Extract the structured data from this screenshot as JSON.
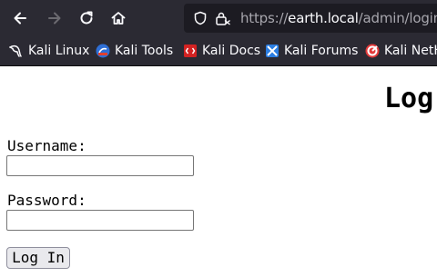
{
  "browser": {
    "url_scheme": "https://",
    "url_host": "earth.local",
    "url_path": "/admin/login",
    "nav": {
      "back_icon": "arrow-left-icon",
      "forward_icon": "arrow-right-icon",
      "reload_icon": "reload-icon",
      "home_icon": "home-icon"
    },
    "bookmarks": [
      {
        "label": "Kali Linux",
        "icon": "kali-dragon-icon"
      },
      {
        "label": "Kali Tools",
        "icon": "kali-tools-icon"
      },
      {
        "label": "Kali Docs",
        "icon": "kali-docs-icon"
      },
      {
        "label": "Kali Forums",
        "icon": "kali-forums-icon"
      },
      {
        "label": "Kali NetH",
        "icon": "kali-nethunter-icon"
      }
    ]
  },
  "page": {
    "title": "Log",
    "username_label": "Username:",
    "password_label": "Password:",
    "username_value": "",
    "password_value": "",
    "submit_label": "Log In"
  },
  "colors": {
    "toolbar_bg": "#2b2a33",
    "urlbar_bg": "#1c1b22",
    "toolbar_text": "#fbfbfe",
    "url_dim": "#a7a6ad"
  }
}
